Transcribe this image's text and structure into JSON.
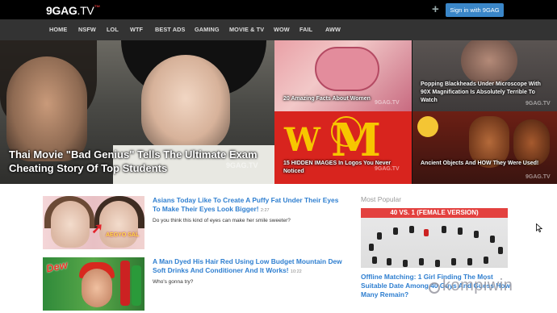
{
  "header": {
    "logo_main": "9GAG",
    "logo_tv": ".TV",
    "logo_sup": "™",
    "signin_label": "Sign in with 9GAG",
    "plus_icon": "plus-icon"
  },
  "nav": {
    "items": [
      "HOME",
      "NSFW",
      "LOL",
      "WTF",
      "BEST ADS",
      "GAMING",
      "MOVIE & TV",
      "WOW",
      "FAIL",
      "AWW"
    ]
  },
  "hero": {
    "main_caption": "Thai Movie \"Bad Genius\" Tells The Ultimate Exam Cheating Story Of Top Students",
    "watermark": "9GAG.TV",
    "tiles": [
      {
        "caption": "20 Amazing Facts About Women"
      },
      {
        "caption": "Popping Blackheads Under Microscope With 90X Magnification Is Absolutely Terrible To Watch"
      },
      {
        "caption": "15 HIDDEN IMAGES In Logos You Never Noticed"
      },
      {
        "caption": "Ancient Objects And HOW They Were Used!"
      }
    ]
  },
  "articles": [
    {
      "title": "Asians Today Like To Create A Puffy Fat Under Their Eyes To Make Their Eyes Look Bigger!",
      "time": "2:27",
      "desc": "Do you think this kind of eyes can make her smile sweeter?",
      "thumb_label": "AEGYO SAL"
    },
    {
      "title": "A Man Dyed His Hair Red Using Low Budget Mountain Dew Soft Drinks And Conditioner And It Works!",
      "time": "10:22",
      "desc": "Who's gonna try?",
      "thumb_label": "Dew"
    }
  ],
  "sidebar": {
    "heading": "Most Popular",
    "banner": "40 VS. 1 (FEMALE VERSION)",
    "item_title": "Offline Matching: 1 Girl Finding The Most Suitable Date Among 40 Guys And Guess How Many Remain?"
  },
  "overlay": {
    "brand": "kompiwin"
  }
}
